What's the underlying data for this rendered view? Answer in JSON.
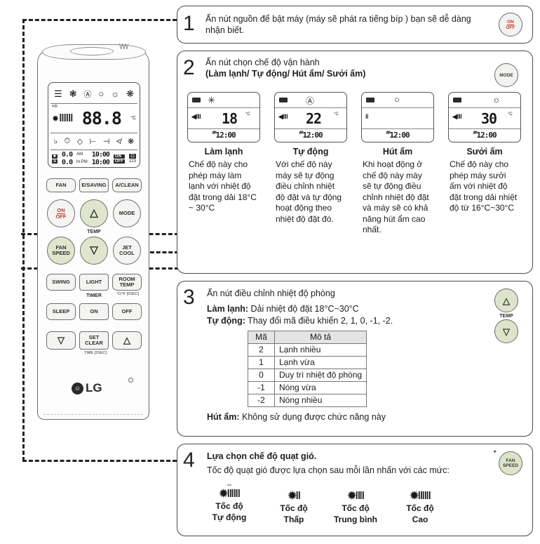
{
  "remote": {
    "name": "LG air conditioner remote control",
    "lcd": {
      "row1_icons": [
        "signal-icon",
        "snowflake-icon",
        "ai-icon",
        "droplet-icon",
        "sun-icon",
        "fan-icon"
      ],
      "row2": {
        "swing_arrow": "⇨",
        "fan_symbol": "✹",
        "fan_bars": "‖‖‖",
        "temp_value": "88.8",
        "unit": "°C"
      },
      "row3_icons": [
        "bell-icon",
        "timer-icon",
        "plasma-icon",
        "in-icon",
        "out-icon",
        "heater-icon",
        "fan2-icon"
      ],
      "row4": {
        "left_top": "0.0",
        "left_bottom": "0.0",
        "hr_label": "hr.",
        "am_label": "AM",
        "pm_label": "PM",
        "time_top": "10:00",
        "time_bottom": "10:00",
        "on_label": "ON",
        "off_label": "OFF",
        "count_label": "123"
      }
    },
    "buttons": [
      {
        "name": "fan-button",
        "label": "FAN"
      },
      {
        "name": "energy-saving-button",
        "label": "E/SAVING"
      },
      {
        "name": "auto-clean-button",
        "label": "A/CLEAN"
      },
      {
        "name": "on-off-button",
        "label": "ON\nOFF"
      },
      {
        "name": "temp-up-button",
        "label": "△"
      },
      {
        "name": "mode-button",
        "label": "MODE"
      },
      {
        "name": "fan-speed-button",
        "label": "FAN\nSPEED"
      },
      {
        "name": "temp-down-button",
        "label": "▽"
      },
      {
        "name": "jet-cool-button",
        "label": "JET\nCOOL"
      },
      {
        "name": "swing-button",
        "label": "SWING"
      },
      {
        "name": "light-button",
        "label": "LIGHT"
      },
      {
        "name": "room-temp-button",
        "label": "ROOM\nTEMP"
      },
      {
        "name": "sleep-button",
        "label": "SLEEP"
      },
      {
        "name": "timer-on-button",
        "label": "ON"
      },
      {
        "name": "timer-off-button",
        "label": "OFF"
      },
      {
        "name": "time-down-button",
        "label": "▽"
      },
      {
        "name": "set-clear-button",
        "label": "SET\nCLEAR"
      },
      {
        "name": "time-up-button",
        "label": "△"
      }
    ],
    "labels": {
      "temp": "TEMP",
      "timer": "TIMER",
      "room_temp_sub": "°C/°F [5SEC]",
      "time_sub": "TIME [3SEC]"
    },
    "brand": "LG"
  },
  "steps": [
    {
      "number": "1",
      "text": "Ấn nút nguồn để bật máy (máy sẽ phát ra tiếng bíp )  bạn sẽ dễ dàng nhận biết.",
      "button": {
        "name": "on-off-button",
        "line1": "ON",
        "line2": "OFF"
      }
    },
    {
      "number": "2",
      "title_line1": "Ấn nút chọn chế độ vận hành",
      "title_line2": "(Làm lạnh/ Tự động/ Hút ẩm/ Sưởi ấm)",
      "button": {
        "name": "mode-button",
        "label": "MODE"
      }
    },
    {
      "number": "3",
      "title": "Ấn nút điều chỉnh nhiệt độ phòng",
      "line_cool_bold": "Làm lạnh:",
      "line_cool_rest": " Dải nhiệt độ đặt 18°C~30°C",
      "line_auto_bold": "Tự động:",
      "line_auto_rest": " Thay đổi mã điều khiển  2, 1, 0, -1, -2.",
      "line_dry_bold": "Hút ẩm:",
      "line_dry_rest": " Không sử dụng được chức năng này",
      "temp_label": "TEMP"
    },
    {
      "number": "4",
      "title": "Lựa chọn chế độ quạt gió.",
      "subtitle": "Tốc độ quạt gió được lựa chọn sau mỗi lần nhấn với các mức:",
      "button": {
        "name": "fan-speed-button",
        "line1": "FAN",
        "line2": "SPEED"
      }
    }
  ],
  "modes": [
    {
      "name": "cool-mode",
      "icon": "✳",
      "icon_name": "snowflake-icon",
      "temp": "18",
      "unit": "°C",
      "fan_bars": "◀‖‖",
      "time": "12:00",
      "ampm": "AM",
      "title": "Làm lạnh",
      "desc": "Chế độ này cho phép máy làm lạnh với nhiệt độ đặt trong dải 18°C ~ 30°C"
    },
    {
      "name": "auto-mode",
      "icon": "Ⓐ",
      "icon_name": "ai-icon",
      "temp": "22",
      "unit": "°C",
      "fan_bars": "◀‖‖",
      "time": "12:00",
      "ampm": "AM",
      "title": "Tự động",
      "desc": "Với chế độ này máy sẽ tự động điều chỉnh nhiệt độ đặt và tự động hoạt động theo nhiệt độ đặt đó."
    },
    {
      "name": "dry-mode",
      "icon": "○",
      "icon_name": "droplet-icon",
      "temp": "",
      "unit": "",
      "fan_bars": "‖",
      "time": "12:00",
      "ampm": "AM",
      "title": "Hút ẩm",
      "desc": "Khi hoạt động ở chế độ này máy sẽ tự động điều chỉnh nhiệt độ đặt và máy sẽ có khả năng hút ẩm cao nhất."
    },
    {
      "name": "heat-mode",
      "icon": "☼",
      "icon_name": "sun-icon",
      "temp": "30",
      "unit": "°C",
      "fan_bars": "◀‖‖",
      "time": "12:00",
      "ampm": "AM",
      "title": "Sưởi ấm",
      "desc": "Chế độ này cho phép máy sưởi ấm với nhiệt độ đặt trong dải nhiệt độ từ 16°C~30°C"
    }
  ],
  "code_table": {
    "headers": [
      "Mã",
      "Mô tả"
    ],
    "rows": [
      {
        "code": "2",
        "desc": "Lạnh nhiều"
      },
      {
        "code": "1",
        "desc": "Lạnh vừa"
      },
      {
        "code": "0",
        "desc": "Duy trì nhiệt độ phòng"
      },
      {
        "code": "-1",
        "desc": "Nóng vừa"
      },
      {
        "code": "-2",
        "desc": "Nóng nhiều"
      }
    ]
  },
  "fan_speeds": [
    {
      "name": "fan-speed-auto",
      "icon": "✹‖‖‖",
      "label_line1": "Tốc độ",
      "label_line2": "Tự động",
      "has_arrow": true
    },
    {
      "name": "fan-speed-low",
      "icon": "✹‖",
      "label_line1": "Tốc độ",
      "label_line2": "Thấp",
      "has_arrow": false
    },
    {
      "name": "fan-speed-medium",
      "icon": "✹‖‖",
      "label_line1": "Tốc độ",
      "label_line2": "Trung bình",
      "has_arrow": false
    },
    {
      "name": "fan-speed-high",
      "icon": "✹‖‖‖",
      "label_line1": "Tốc độ",
      "label_line2": "Cao",
      "has_arrow": false
    }
  ],
  "colors": {
    "accent_red": "#c0392b",
    "button_green": "#dde4c9",
    "border": "#4a4a4a"
  }
}
